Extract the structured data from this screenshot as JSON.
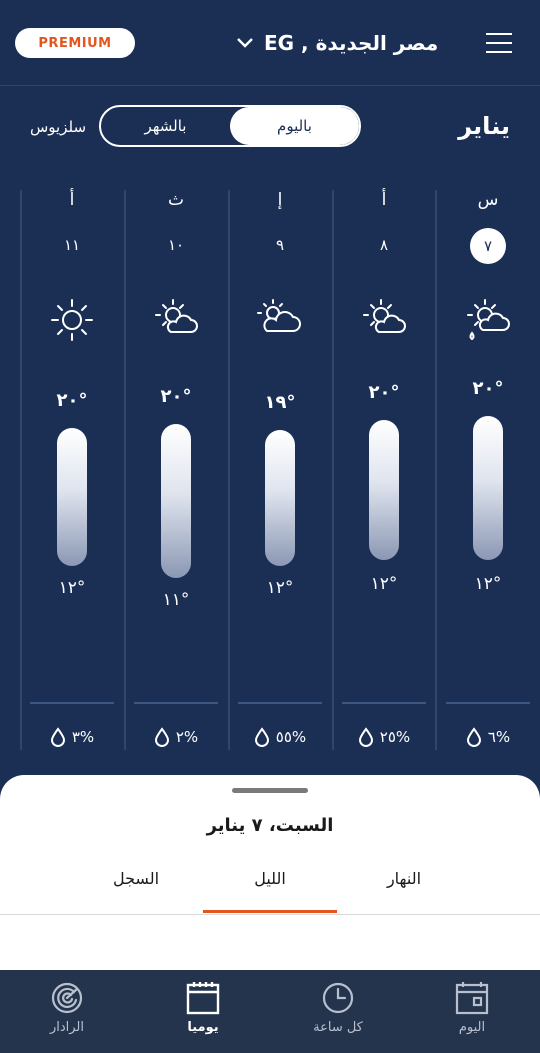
{
  "header": {
    "premium_label": "PREMIUM",
    "location": "مصر الجديدة , EG"
  },
  "controls": {
    "month": "يناير",
    "toggle_daily": "باليوم",
    "toggle_monthly": "بالشهر",
    "unit": "سلزيوس"
  },
  "days": [
    {
      "letter": "س",
      "num": "٧",
      "selected": true,
      "icon": "partly-cloudy-rain-icon",
      "hi": "٢٠°",
      "lo": "١٢°",
      "rain": "٦%"
    },
    {
      "letter": "أ",
      "num": "٨",
      "selected": false,
      "icon": "partly-cloudy-icon",
      "hi": "٢٠°",
      "lo": "١٢°",
      "rain": "٢٥%"
    },
    {
      "letter": "إ",
      "num": "٩",
      "selected": false,
      "icon": "cloud-sun-icon",
      "hi": "١٩°",
      "lo": "١٢°",
      "rain": "٥٥%"
    },
    {
      "letter": "ث",
      "num": "١٠",
      "selected": false,
      "icon": "partly-cloudy-icon",
      "hi": "٢٠°",
      "lo": "١١°",
      "rain": "٢%"
    },
    {
      "letter": "أ",
      "num": "١١",
      "selected": false,
      "icon": "sun-icon",
      "hi": "٢٠°",
      "lo": "١٢°",
      "rain": "٣%"
    }
  ],
  "sheet": {
    "title": "السبت، ٧ يناير",
    "tab_day": "النهار",
    "tab_night": "الليل",
    "tab_history": "السجل"
  },
  "nav": {
    "today": "اليوم",
    "hourly": "كل ساعة",
    "daily": "يوميا",
    "radar": "الرادار"
  },
  "colors": {
    "background": "#1b2f55",
    "accent": "#e3571f",
    "nav_background": "#25344d"
  }
}
